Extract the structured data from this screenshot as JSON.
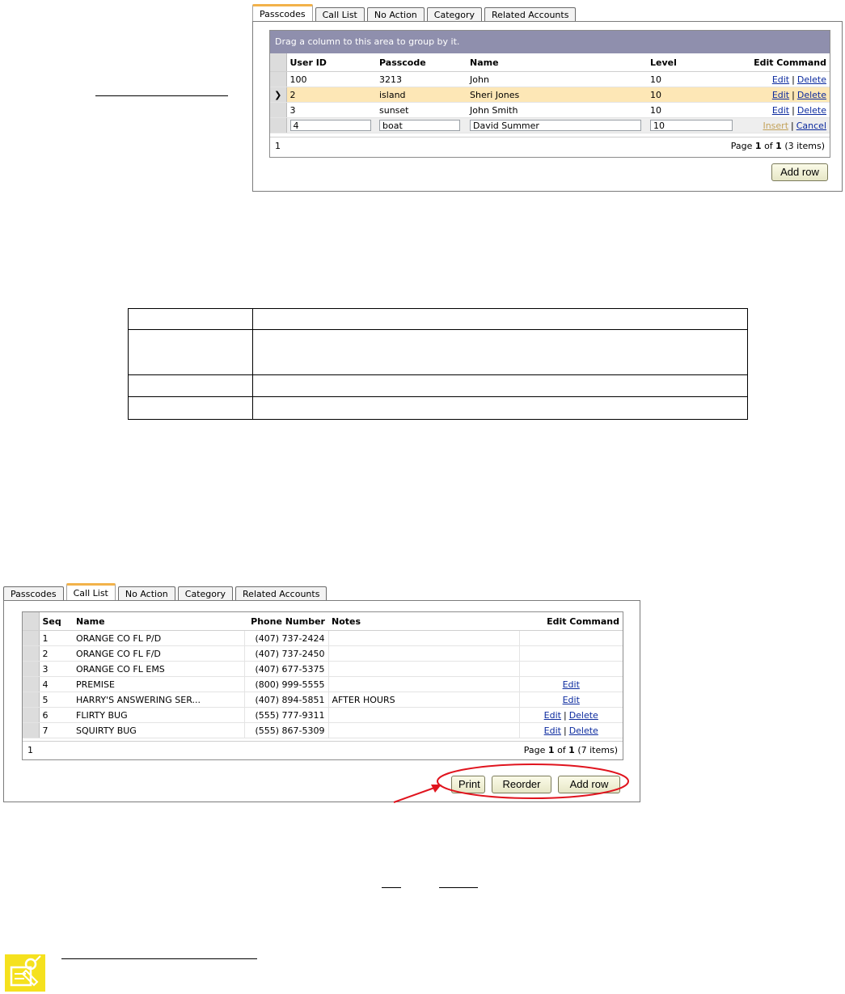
{
  "top_panel": {
    "tabs": [
      "Passcodes",
      "Call List",
      "No Action",
      "Category",
      "Related Accounts"
    ],
    "active_tab": "Passcodes",
    "group_hint": "Drag a column to this area to group by it.",
    "columns": [
      "User ID",
      "Passcode",
      "Name",
      "Level",
      "Edit Command"
    ],
    "rows": [
      {
        "user_id": "100",
        "passcode": "3213",
        "name": "John",
        "level": "10",
        "edit": "Edit",
        "delete": "Delete"
      },
      {
        "user_id": "2",
        "passcode": "island",
        "name": "Sheri Jones",
        "level": "10",
        "edit": "Edit",
        "delete": "Delete"
      },
      {
        "user_id": "3",
        "passcode": "sunset",
        "name": "John Smith",
        "level": "10",
        "edit": "Edit",
        "delete": "Delete"
      }
    ],
    "edit_row": {
      "user_id": "4",
      "passcode": "boat",
      "name": "David Summer",
      "level": "10",
      "insert": "Insert",
      "cancel": "Cancel"
    },
    "selected_row_marker": "❯",
    "separator": "|",
    "pager": {
      "page_number": "1",
      "page_prefix": "Page",
      "current": "1",
      "of": "of",
      "total": "1",
      "items": "(3 items)"
    },
    "add_row": "Add row"
  },
  "bottom_panel": {
    "tabs": [
      "Passcodes",
      "Call List",
      "No Action",
      "Category",
      "Related Accounts"
    ],
    "active_tab": "Call List",
    "columns": [
      "Seq",
      "Name",
      "Phone Number",
      "Notes",
      "Edit Command"
    ],
    "rows": [
      {
        "seq": "1",
        "name": "ORANGE CO FL P/D",
        "phone": "(407) 737-2424",
        "notes": "",
        "edit": "",
        "delete": ""
      },
      {
        "seq": "2",
        "name": "ORANGE CO FL F/D",
        "phone": "(407) 737-2450",
        "notes": "",
        "edit": "",
        "delete": ""
      },
      {
        "seq": "3",
        "name": "ORANGE CO FL EMS",
        "phone": "(407) 677-5375",
        "notes": "",
        "edit": "",
        "delete": ""
      },
      {
        "seq": "4",
        "name": "PREMISE",
        "phone": "(800) 999-5555",
        "notes": "",
        "edit": "Edit",
        "delete": ""
      },
      {
        "seq": "5",
        "name": "HARRY'S ANSWERING SER...",
        "phone": "(407) 894-5851",
        "notes": "AFTER HOURS",
        "edit": "Edit",
        "delete": ""
      },
      {
        "seq": "6",
        "name": "FLIRTY BUG",
        "phone": "(555) 777-9311",
        "notes": "",
        "edit": "Edit",
        "delete": "Delete"
      },
      {
        "seq": "7",
        "name": "SQUIRTY BUG",
        "phone": "(555) 867-5309",
        "notes": "",
        "edit": "Edit",
        "delete": "Delete"
      }
    ],
    "separator": "|",
    "pager": {
      "page_number": "1",
      "page_prefix": "Page",
      "current": "1",
      "of": "of",
      "total": "1",
      "items": "(7 items)"
    },
    "buttons": {
      "print": "Print",
      "reorder": "Reorder",
      "add_row": "Add row"
    }
  },
  "annotation_color": "#e0141e",
  "note_icon_color": "#f5e11e"
}
